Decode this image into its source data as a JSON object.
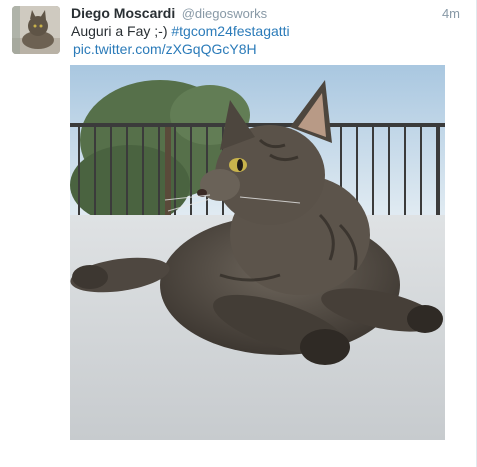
{
  "tweet": {
    "avatar_icon": "cat-avatar-icon",
    "display_name": "Diego Moscardi",
    "username": "@diegosworks",
    "timestamp": "4m",
    "text": "Auguri a Fay ;-) ",
    "hashtag": "#tgcom24festagatti",
    "pic_link": "pic.twitter.com/zXGqQGcY8H",
    "photo_icon": "cat-photo-icon"
  },
  "colors": {
    "link": "#2b7bb9",
    "name": "#292f33",
    "meta": "#8899a6"
  }
}
